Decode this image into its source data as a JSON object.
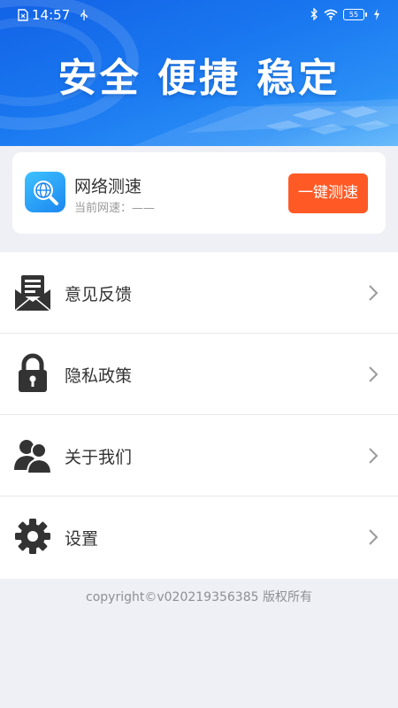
{
  "status_bar": {
    "time": "14:57",
    "battery_level": "55"
  },
  "banner": {
    "slogan": "安全 便捷 稳定"
  },
  "speed_card": {
    "title": "网络测速",
    "current_speed_label": "当前网速：——",
    "button_label": "一键测速",
    "button_color": "#ff5a26"
  },
  "menu": {
    "items": [
      {
        "label": "意见反馈",
        "icon": "feedback-mail-icon"
      },
      {
        "label": "隐私政策",
        "icon": "lock-icon"
      },
      {
        "label": "关于我们",
        "icon": "users-icon"
      },
      {
        "label": "设置",
        "icon": "gear-icon"
      }
    ]
  },
  "footer": {
    "copyright": "copyright©v020219356385 版权所有"
  },
  "colors": {
    "brand_blue": "#1a78f0",
    "accent_orange": "#ff5a26",
    "background": "#eef0f5"
  }
}
